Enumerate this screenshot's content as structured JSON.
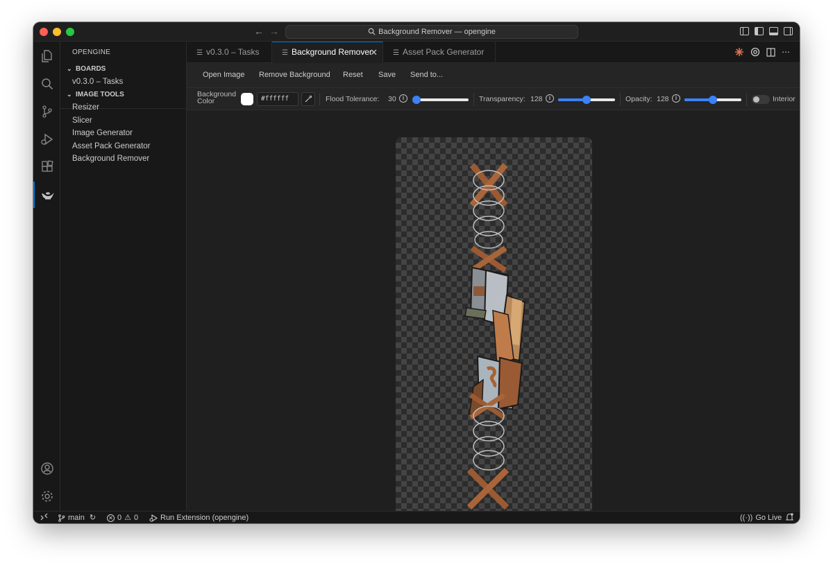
{
  "window": {
    "title": "Background Remover — opengine"
  },
  "activity_bar": {
    "items": [
      "explorer-icon",
      "search-icon",
      "source-control-icon",
      "run-debug-icon",
      "extensions-icon",
      "genie-lamp-icon"
    ],
    "bottom": [
      "account-icon",
      "settings-icon"
    ],
    "accent": "#0078d4"
  },
  "sidebar": {
    "title": "OPENGINE",
    "boards": {
      "label": "BOARDS",
      "items": [
        "v0.3.0 – Tasks"
      ]
    },
    "image_tools": {
      "label": "IMAGE TOOLS",
      "items": [
        "Resizer",
        "Slicer",
        "Image Generator",
        "Asset Pack Generator",
        "Background Remover"
      ]
    }
  },
  "tabs": [
    {
      "label": "v0.3.0 – Tasks",
      "active": false
    },
    {
      "label": "Background Remover",
      "active": true
    },
    {
      "label": "Asset Pack Generator",
      "active": false
    }
  ],
  "toolbar": {
    "open_label": "Open Image",
    "remove_label": "Remove Background",
    "reset_label": "Reset",
    "save_label": "Save",
    "send_label": "Send to..."
  },
  "controls": {
    "bg_color_label_line1": "Background",
    "bg_color_label_line2": "Color",
    "bg_color_value": "#ffffff",
    "flood_label": "Flood Tolerance:",
    "flood_value": "30",
    "flood_fraction": 0.05,
    "transparency_label": "Transparency:",
    "transparency_value": "128",
    "transparency_fraction": 0.5,
    "opacity_label": "Opacity:",
    "opacity_value": "128",
    "opacity_fraction": 0.5,
    "interior_label": "Interior",
    "slider_color": "#3b82f6"
  },
  "status_bar": {
    "branch": "main",
    "errors": "0",
    "warnings": "0",
    "run_label": "Run Extension (opengine)",
    "go_live_label": "Go Live"
  }
}
